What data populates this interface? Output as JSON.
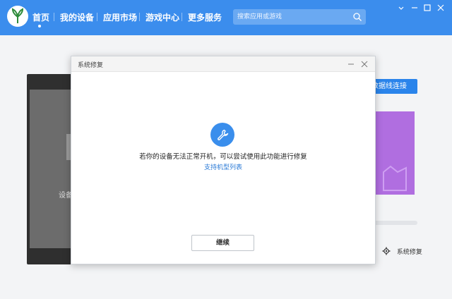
{
  "topbar": {
    "nav": [
      "首页",
      "我的设备",
      "应用市场",
      "游戏中心",
      "更多服务"
    ],
    "search_placeholder": "搜索应用或游戏"
  },
  "background": {
    "phone_text": "设备",
    "connect_button": "数据线连接",
    "repair_label": "系统修复"
  },
  "dialog": {
    "title": "系统修复",
    "message": "若你的设备无法正常开机，可以尝试使用此功能进行修复",
    "link": "支持机型列表",
    "continue_button": "继续"
  },
  "colors": {
    "brand_blue": "#3b8ded",
    "banner_purple": "#b06ee0"
  },
  "icons": [
    "app-logo-icon",
    "search-icon",
    "minimize-icon",
    "maximize-icon",
    "close-icon",
    "wrench-icon",
    "gear-icon"
  ]
}
